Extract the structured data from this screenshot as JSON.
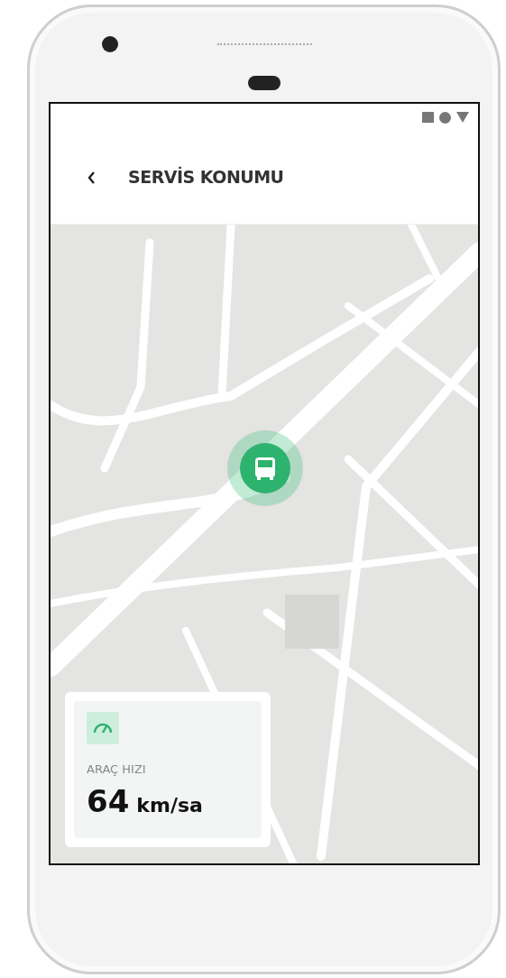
{
  "header": {
    "title": "SERVİS KONUMU"
  },
  "speed_card": {
    "label": "ARAÇ HIZI",
    "value": "64",
    "unit": "km/sa"
  }
}
